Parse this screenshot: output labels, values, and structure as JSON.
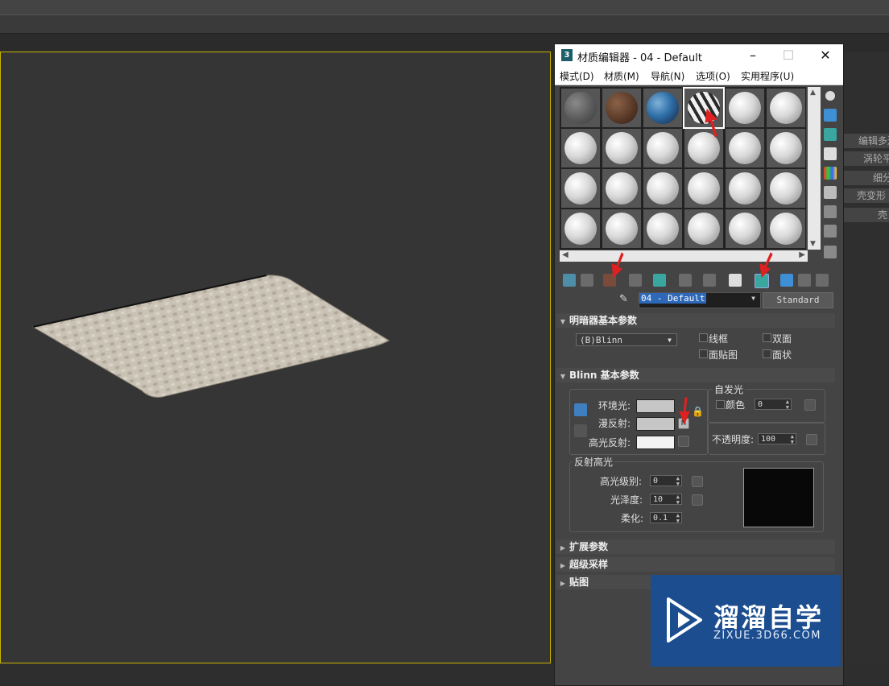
{
  "material_editor": {
    "title": "材质编辑器 - 04 - Default",
    "app_icon": "3",
    "menu": [
      "模式(D)",
      "材质(M)",
      "导航(N)",
      "选项(O)",
      "实用程序(U)"
    ],
    "material_name": "04 - Default",
    "material_type": "Standard",
    "rollouts": {
      "shader_basic": "明暗器基本参数",
      "blinn_basic": "Blinn 基本参数",
      "extended": "扩展参数",
      "supersampling": "超级采样",
      "maps": "贴图"
    },
    "shader": {
      "type": "(B)Blinn",
      "wire": "线框",
      "two_sided": "双面",
      "face_map": "面贴图",
      "faceted": "面状"
    },
    "blinn": {
      "ambient_label": "环境光:",
      "diffuse_label": "漫反射:",
      "specular_label": "高光反射:",
      "m_label": "M",
      "self_illum_title": "自发光",
      "color_label": "颜色",
      "self_illum_value": "0",
      "opacity_label": "不透明度:",
      "opacity_value": "100",
      "spec_highlights_title": "反射高光",
      "spec_level_label": "高光级别:",
      "spec_level_value": "0",
      "glossiness_label": "光泽度:",
      "glossiness_value": "10",
      "soften_label": "柔化:",
      "soften_value": "0.1"
    }
  },
  "command_panel": {
    "items": [
      "编辑多边形",
      "涡轮平滑",
      "细分",
      "壳变形 (WS",
      "壳"
    ]
  },
  "watermark": {
    "title": "溜溜自学",
    "url": "ZIXUE.3D66.COM"
  },
  "colors": {
    "viewport_border": "#c8b400",
    "watermark_bg": "#1b4d8f",
    "arrow": "#e02020"
  }
}
